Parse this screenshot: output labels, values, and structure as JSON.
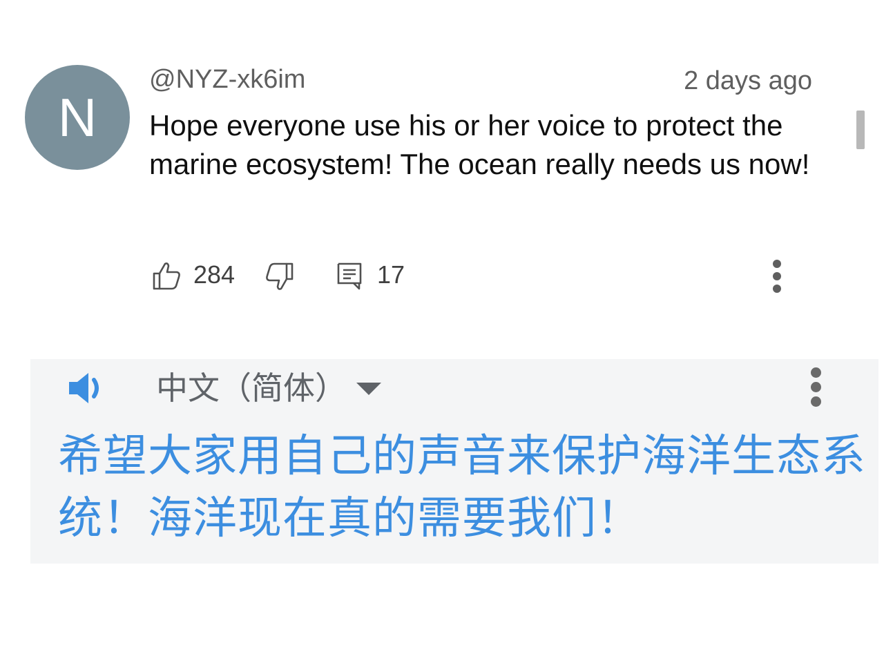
{
  "comment": {
    "avatar_letter": "N",
    "avatar_color": "#7a909b",
    "username": "@NYZ-xk6im",
    "timestamp": "2 days ago",
    "text": "Hope everyone use his or her voice to protect the marine ecosystem! The ocean really needs us now!",
    "like_count": "284",
    "reply_count": "17",
    "icons": {
      "like": "thumbs-up-icon",
      "dislike": "thumbs-down-icon",
      "reply": "comment-icon",
      "more": "more-vert-icon"
    }
  },
  "translation": {
    "language": "中文（简体）",
    "text": "希望大家用自己的声音来保护海洋生态系统！海洋现在真的需要我们！",
    "text_color": "#3c8ee0",
    "panel_background": "#f4f5f6",
    "icons": {
      "speaker": "speaker-icon",
      "dropdown": "dropdown-arrow-icon",
      "more": "more-vert-icon"
    }
  }
}
